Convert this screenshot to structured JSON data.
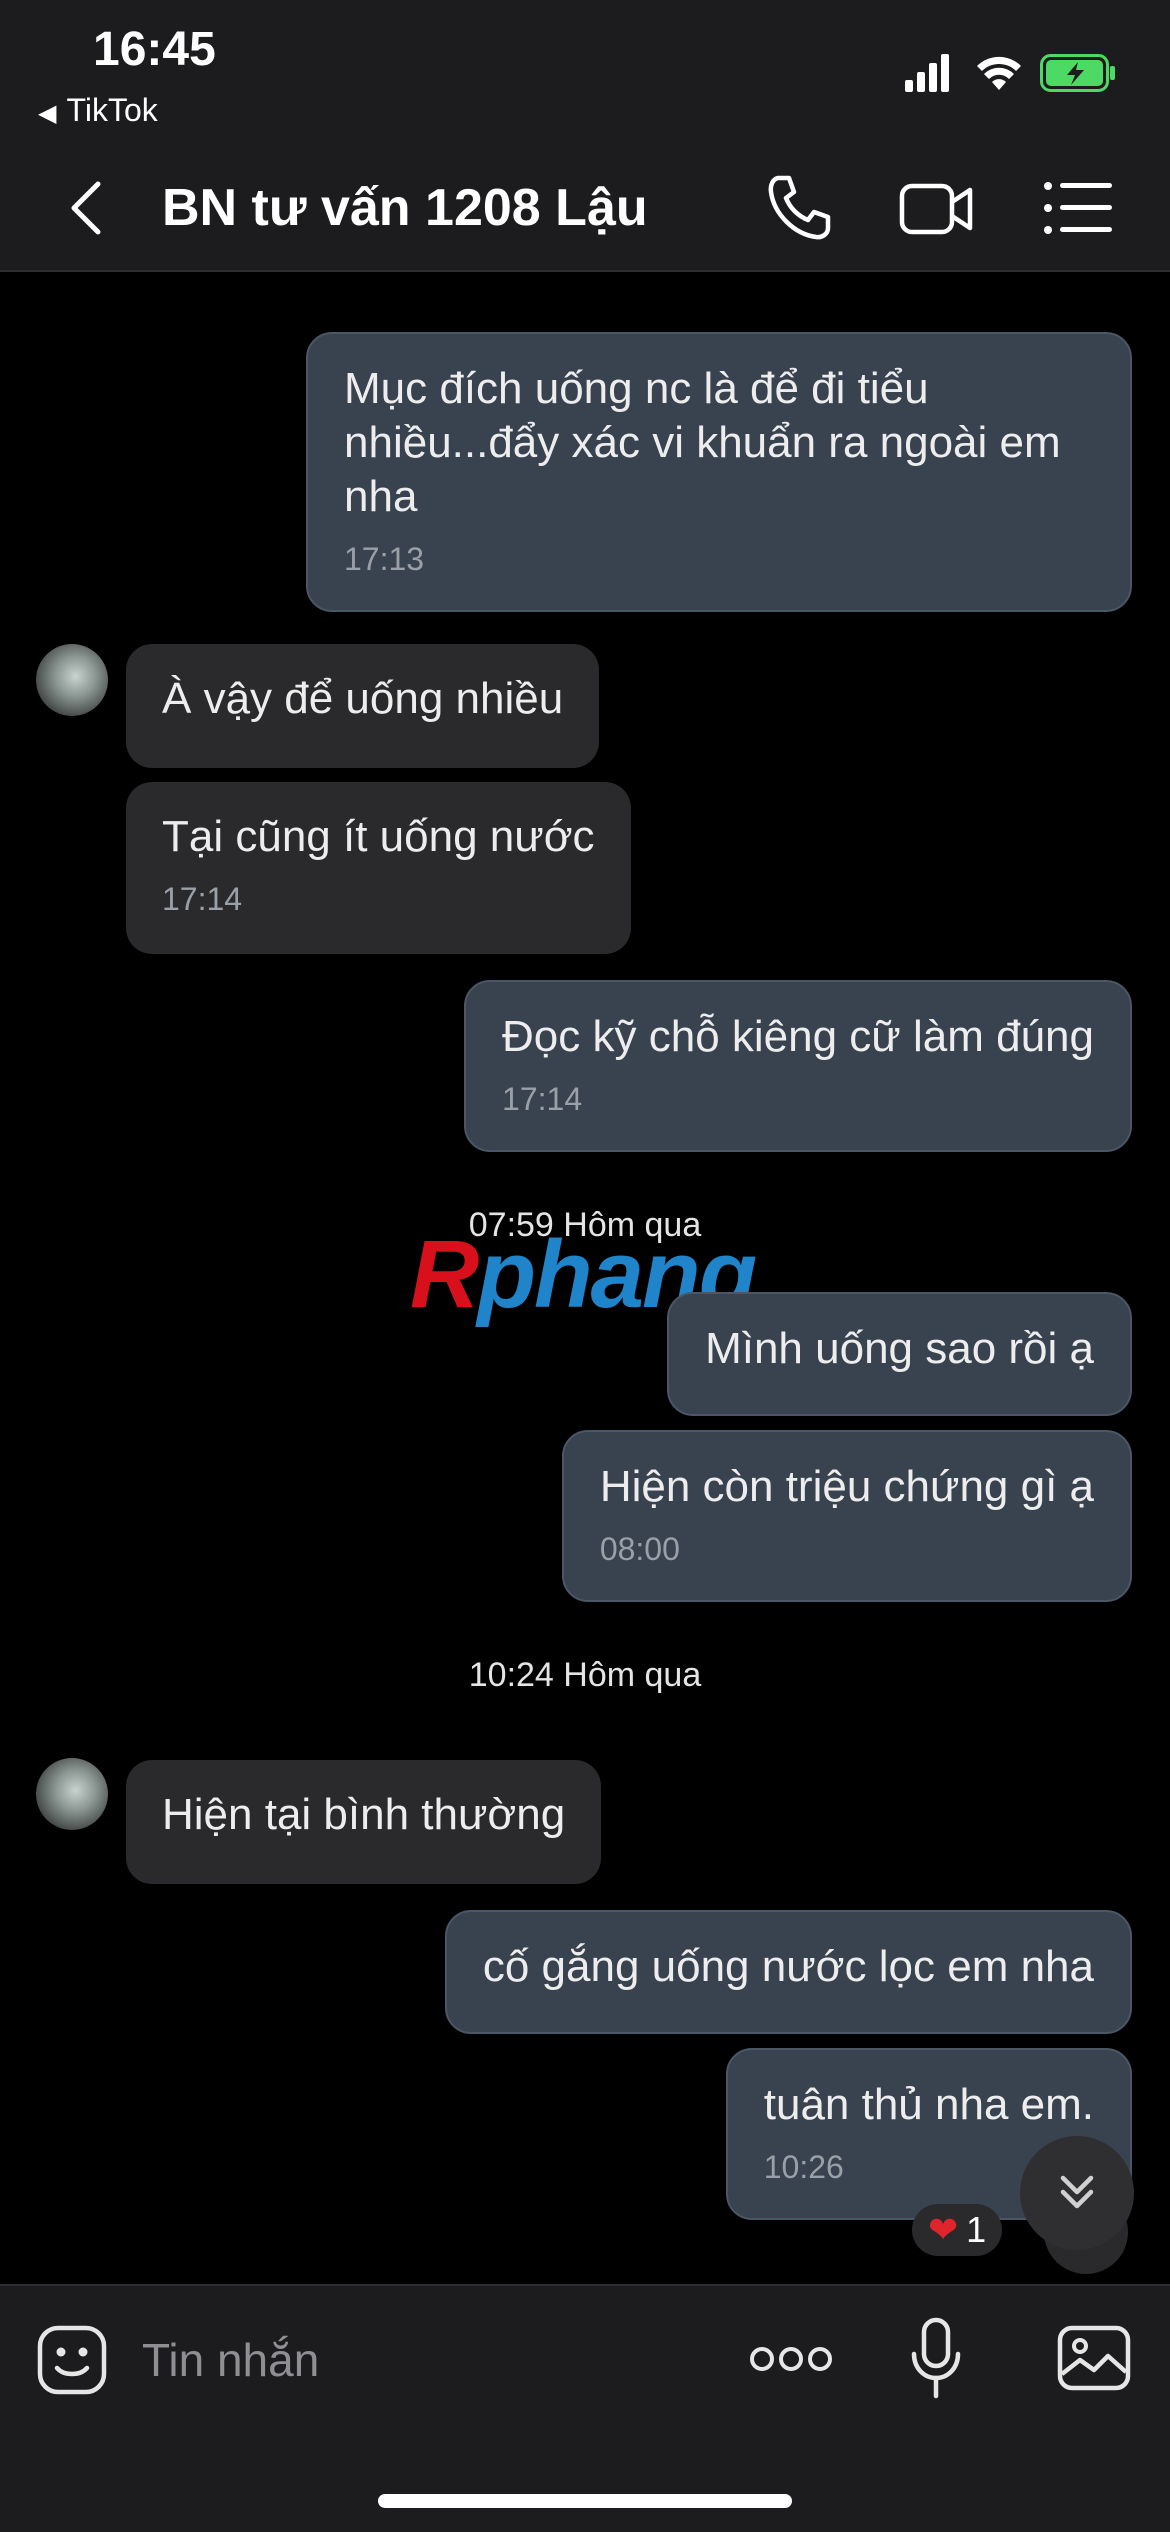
{
  "status_bar": {
    "time": "16:45",
    "back_app": "TikTok"
  },
  "header": {
    "title": "BN tư vấn 1208 Lậu"
  },
  "messages": [
    {
      "side": "out",
      "text": "Mục đích uống nc là để đi tiểu nhiều...đẩy xác vi khuẩn ra ngoài em nha",
      "time": "17:13"
    },
    {
      "side": "in",
      "text": "À vậy để uống nhiều"
    },
    {
      "side": "in",
      "text": "Tại cũng ít uống nước",
      "time": "17:14"
    },
    {
      "side": "out",
      "text": "Đọc kỹ chỗ kiêng cữ làm đúng",
      "time": "17:14"
    },
    {
      "type": "separator",
      "text": "07:59 Hôm qua"
    },
    {
      "side": "out",
      "text": "Mình uống sao rồi ạ"
    },
    {
      "side": "out",
      "text": "Hiện còn triệu chứng gì ạ",
      "time": "08:00"
    },
    {
      "type": "separator",
      "text": "10:24 Hôm qua"
    },
    {
      "side": "in",
      "text": "Hiện tại bình thường"
    },
    {
      "side": "out",
      "text": "cố gắng uống nước lọc em nha"
    },
    {
      "side": "out",
      "text": "tuân thủ nha em.",
      "time": "10:26"
    }
  ],
  "watermark": {
    "first": "R",
    "rest": "phang"
  },
  "reaction": {
    "icon": "heart-icon",
    "count": "1"
  },
  "input": {
    "placeholder": "Tin nhắn"
  },
  "colors": {
    "background": "#000000",
    "bar": "#1c1c1e",
    "outgoing_bubble": "#39424f",
    "incoming_bubble": "#2a2a2c",
    "battery": "#4cd964"
  }
}
